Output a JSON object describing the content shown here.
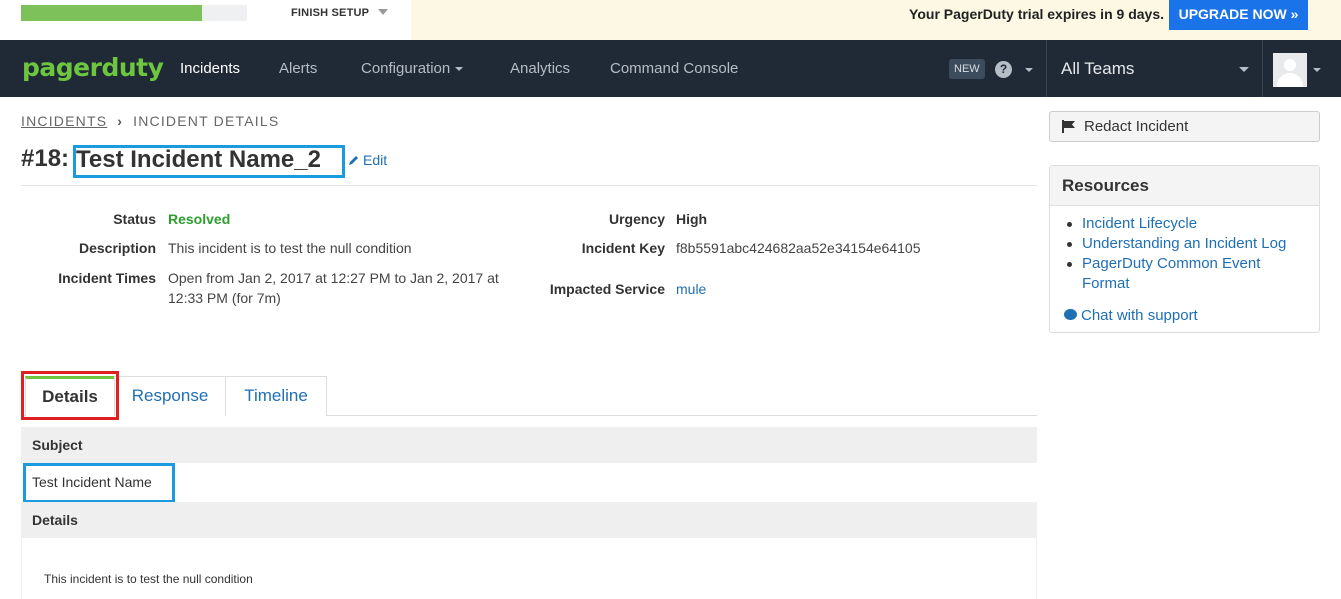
{
  "trial": {
    "progress_percent": 80,
    "finish_setup": "FINISH SETUP",
    "message": "Your PagerDuty trial expires in 9 days.",
    "upgrade": "UPGRADE NOW »"
  },
  "nav": {
    "logo": "pagerduty",
    "items": [
      "Incidents",
      "Alerts",
      "Configuration",
      "Analytics",
      "Command Console"
    ],
    "new_badge": "NEW",
    "help": "?",
    "teams": "All Teams"
  },
  "breadcrumb": {
    "parent": "INCIDENTS",
    "current": "INCIDENT DETAILS"
  },
  "incident": {
    "number": "#18:",
    "name": "Test Incident Name_2",
    "edit": "Edit",
    "labels": {
      "status": "Status",
      "description": "Description",
      "times": "Incident Times",
      "urgency": "Urgency",
      "key": "Incident Key",
      "service": "Impacted Service"
    },
    "status": "Resolved",
    "description": "This incident is to test the null condition",
    "times_line1": "Open from Jan 2, 2017 at 12:27 PM to Jan 2, 2017 at",
    "times_line2": "12:33 PM (for 7m)",
    "urgency": "High",
    "key": "f8b5591abc424682aa52e34154e64105",
    "service": "mule"
  },
  "tabs": [
    "Details",
    "Response",
    "Timeline"
  ],
  "details": {
    "subject_label": "Subject",
    "subject_value": "Test Incident Name",
    "details_label": "Details",
    "details_value": "This incident is to test the null condition"
  },
  "sidebar": {
    "redact": "Redact Incident",
    "resources_title": "Resources",
    "links": [
      "Incident Lifecycle",
      "Understanding an Incident Log",
      "PagerDuty Common Event",
      "Format"
    ],
    "chat": "Chat with support"
  },
  "colors": {
    "brand_green": "#6ec63f",
    "nav_bg": "#1f2a36",
    "link_blue": "#1f6fb5",
    "upgrade_blue": "#1a73e8",
    "highlight_blue": "#1a9be0",
    "highlight_red": "#e02020"
  }
}
